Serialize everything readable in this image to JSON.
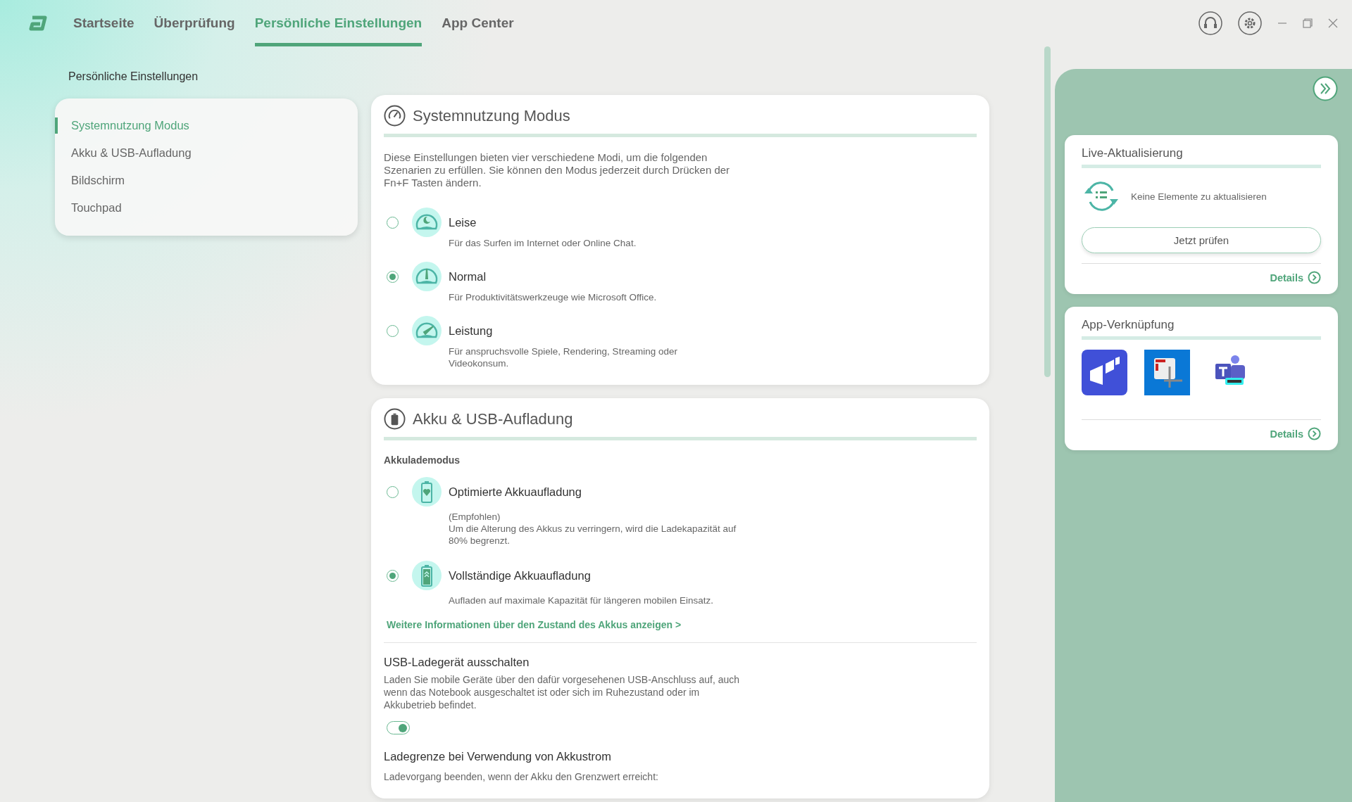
{
  "nav": {
    "tabs": [
      {
        "label": "Startseite",
        "selected": false
      },
      {
        "label": "Überprüfung",
        "selected": false
      },
      {
        "label": "Persönliche Einstellungen",
        "selected": true
      },
      {
        "label": "App Center",
        "selected": false
      }
    ]
  },
  "breadcrumb": "Persönliche Einstellungen",
  "sidebar": {
    "items": [
      {
        "label": "Systemnutzung Modus",
        "selected": true
      },
      {
        "label": "Akku & USB-Aufladung",
        "selected": false
      },
      {
        "label": "Bildschirm",
        "selected": false
      },
      {
        "label": "Touchpad",
        "selected": false
      }
    ]
  },
  "mode_section": {
    "title": "Systemnutzung Modus",
    "description": "Diese Einstellungen bieten vier verschiedene Modi, um die folgenden Szenarien zu erfüllen. Sie können den Modus jederzeit durch Drücken der Fn+F Tasten ändern.",
    "options": [
      {
        "label": "Leise",
        "description": "Für das Surfen im Internet oder Online Chat.",
        "selected": false
      },
      {
        "label": "Normal",
        "description": "Für Produktivitätswerkzeuge wie Microsoft Office.",
        "selected": true
      },
      {
        "label": "Leistung",
        "description": "Für anspruchsvolle Spiele, Rendering, Streaming oder Videokonsum.",
        "selected": false
      }
    ]
  },
  "battery_section": {
    "title": "Akku & USB-Aufladung",
    "subheading": "Akkulademodus",
    "options": [
      {
        "label": "Optimierte Akkuaufladung",
        "note": "(Empfohlen)",
        "description": "Um die Alterung des Akkus zu verringern, wird die Ladekapazität auf 80% begrenzt.",
        "selected": false
      },
      {
        "label": "Vollständige Akkuaufladung",
        "description": "Aufladen auf maximale Kapazität für längeren mobilen Einsatz.",
        "selected": true
      }
    ],
    "link": "Weitere Informationen über den Zustand des Akkus anzeigen >",
    "usb": {
      "title": "USB-Ladegerät ausschalten",
      "description": "Laden Sie mobile Geräte über den dafür vorgesehenen USB-Anschluss auf, auch wenn das Notebook ausgeschaltet ist oder sich im Ruhezustand oder im Akkubetrieb befindet.",
      "on": true
    },
    "limit": {
      "title": "Ladegrenze bei Verwendung von Akkustrom",
      "description": "Ladevorgang beenden, wenn der Akku den Grenzwert erreicht:"
    }
  },
  "right_panel": {
    "live_update": {
      "title": "Live-Aktualisierung",
      "message": "Keine Elemente zu aktualisieren",
      "button": "Jetzt prüfen",
      "details": "Details"
    },
    "app_links": {
      "title": "App-Verknüpfung",
      "details": "Details"
    }
  }
}
